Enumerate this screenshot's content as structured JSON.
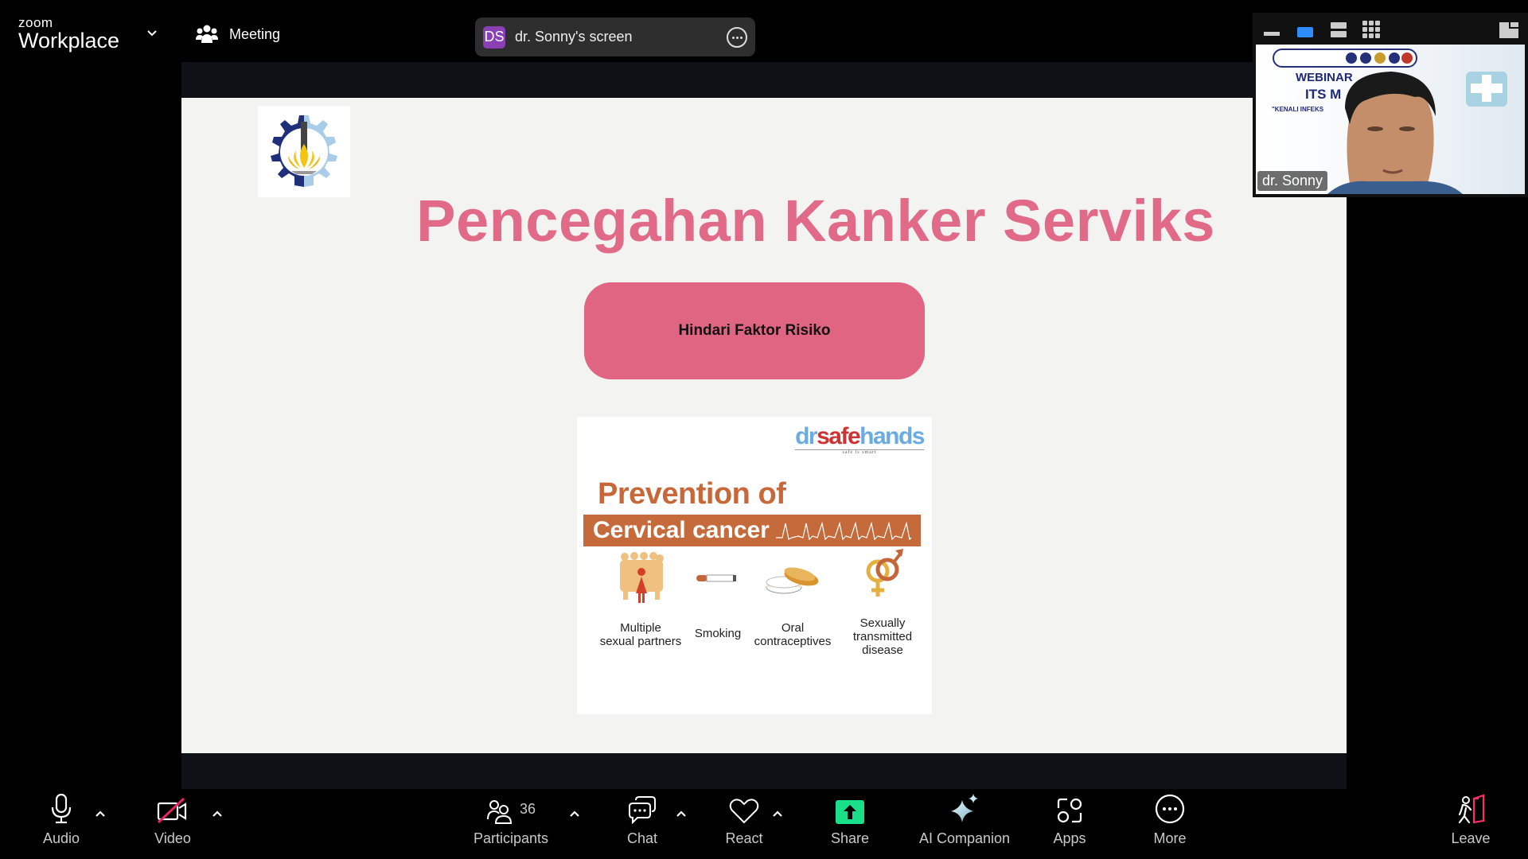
{
  "topbar": {
    "brand_top": "zoom",
    "brand_bottom": "Workplace",
    "meeting_label": "Meeting",
    "screen_share": {
      "initials": "DS",
      "label": "dr. Sonny's screen",
      "badge_color": "#8b3fb5"
    }
  },
  "slide": {
    "title": "Pencegahan Kanker Serviks",
    "title_color": "#e06a87",
    "risk_button_label": "Hindari Faktor Risiko",
    "logo": "its-logo",
    "poster": {
      "brand_dr": "dr",
      "brand_safe": "safe",
      "brand_hands": "hands",
      "brand_tagline": "safe is smart",
      "heading_line1": "Prevention of",
      "heading_line2": "Cervical cancer",
      "risk_factors": [
        {
          "label_line1": "Multiple",
          "label_line2": "sexual partners",
          "label_line3": "",
          "icon": "people-icon"
        },
        {
          "label_line1": "Smoking",
          "label_line2": "",
          "label_line3": "",
          "icon": "cigarette-icon"
        },
        {
          "label_line1": "Oral",
          "label_line2": "contraceptives",
          "label_line3": "",
          "icon": "pill-case-icon"
        },
        {
          "label_line1": "Sexually",
          "label_line2": "transmitted",
          "label_line3": "disease",
          "icon": "gender-symbols-icon"
        }
      ]
    }
  },
  "self_view": {
    "name": "dr. Sonny",
    "background_text_1": "WEBINAR",
    "background_text_2": "ITS M",
    "background_text_3": "\"KENALI INFEKS"
  },
  "toolbar": {
    "audio": "Audio",
    "video": "Video",
    "participants": "Participants",
    "participant_count": "36",
    "chat": "Chat",
    "react": "React",
    "share": "Share",
    "ai_companion": "AI Companion",
    "apps": "Apps",
    "more": "More",
    "leave": "Leave",
    "share_color": "#19e088",
    "leave_accent": "#ff2d6b"
  }
}
